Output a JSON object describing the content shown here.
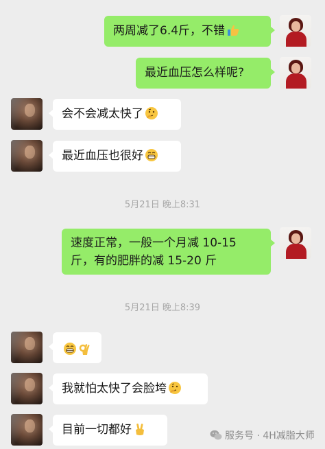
{
  "messages": [
    {
      "text": "两周减了6.4斤，不错",
      "emoji": "thumbs-up-emoji"
    },
    {
      "text": "最近血压怎么样呢?"
    },
    {
      "text": "会不会减太快了",
      "emoji": "thinking-emoji"
    },
    {
      "text": "最近血压也很好",
      "emoji": "grin-emoji"
    },
    {
      "text": "速度正常，一般一个月减 10-15",
      "text2": "斤，有的肥胖的减 15-20 斤"
    },
    {
      "text": "",
      "emoji": "grin-emoji",
      "emoji2": "ok-hand-emoji"
    },
    {
      "text": "我就怕太快了会脸垮",
      "emoji": "thinking-emoji"
    },
    {
      "text": "目前一切都好",
      "emoji": "victory-hand-emoji"
    }
  ],
  "timestamps": [
    "5月21日 晚上8:31",
    "5月21日 晚上8:39"
  ],
  "watermark": "服务号 · 4H减脂大师",
  "colors": {
    "outgoing": "#95ec69",
    "incoming": "#ffffff",
    "background": "#ededed"
  }
}
